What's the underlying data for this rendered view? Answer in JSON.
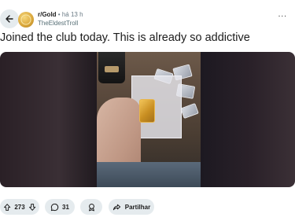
{
  "post": {
    "subreddit": "r/Gold",
    "separator": "•",
    "time": "há 13 h",
    "author": "TheEldestTroll",
    "title": "Joined the club today. This is already so addictive",
    "more_label": "..."
  },
  "actions": {
    "vote_count": "273",
    "comment_count": "31",
    "share_label": "Partilhar"
  },
  "colors": {
    "pill_bg": "#e5ebee",
    "text": "#1c1c1c",
    "muted": "#576f76"
  }
}
